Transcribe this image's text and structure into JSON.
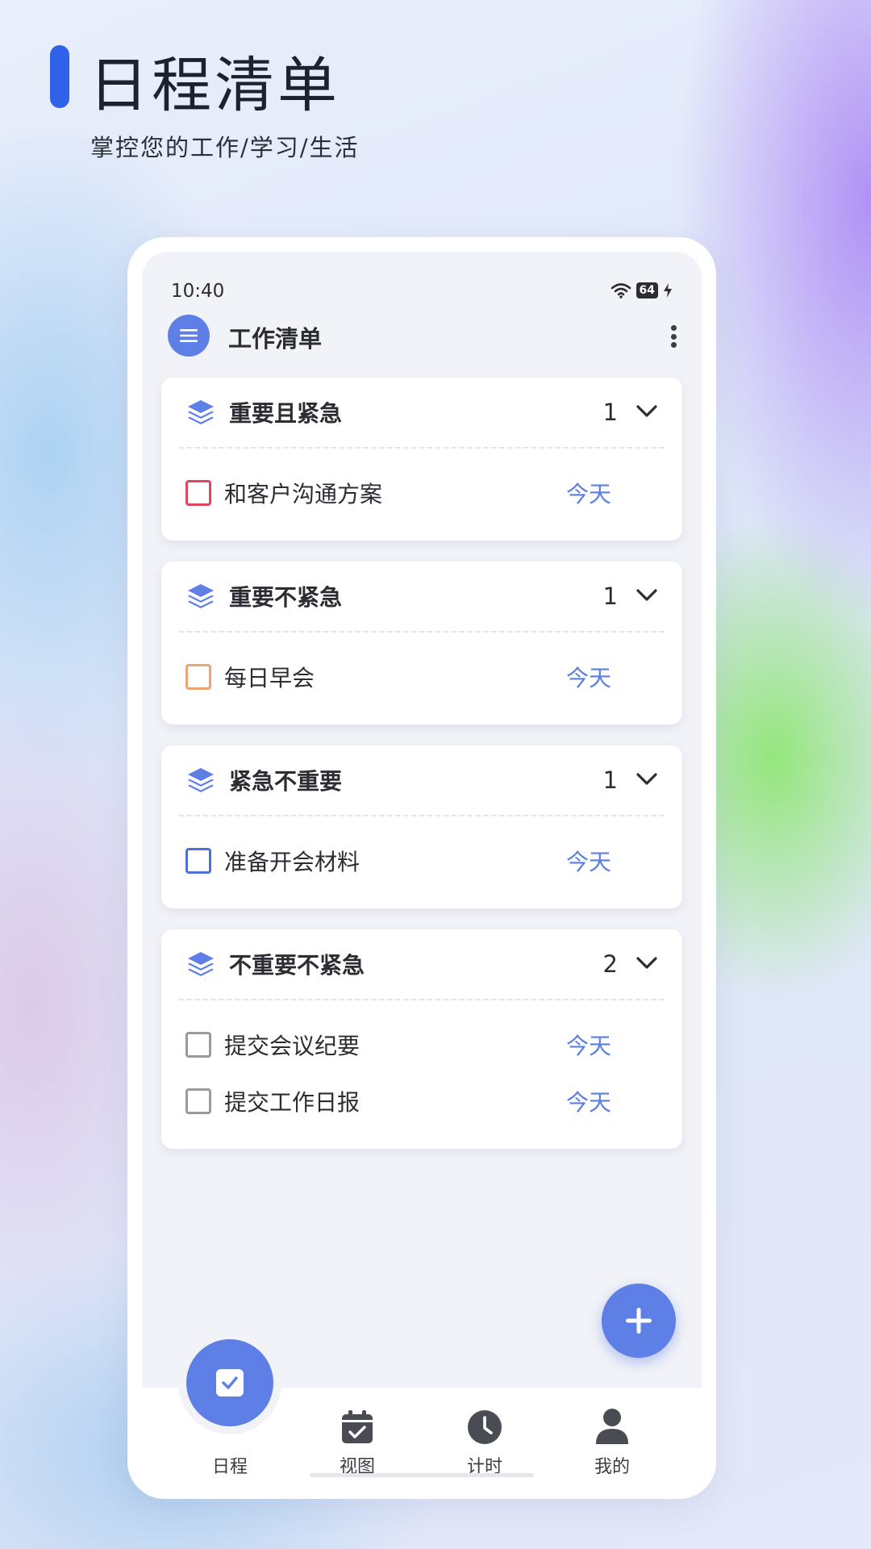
{
  "hero": {
    "title": "日程清单",
    "subtitle": "掌控您的工作/学习/生活"
  },
  "status_bar": {
    "time": "10:40",
    "battery": "64"
  },
  "header": {
    "title": "工作清单"
  },
  "colors": {
    "accent": "#5e7fe6",
    "brand_bar": "#2f62e8",
    "date_text": "#5b7fe0",
    "urgent_important": "#e0455f",
    "important": "#f0a474",
    "urgent": "#4d6fd6",
    "neither": "#9a9a9a"
  },
  "quadrants": [
    {
      "title": "重要且紧急",
      "count": "1",
      "tasks": [
        {
          "text": "和客户沟通方案",
          "date": "今天"
        }
      ]
    },
    {
      "title": "重要不紧急",
      "count": "1",
      "tasks": [
        {
          "text": "每日早会",
          "date": "今天"
        }
      ]
    },
    {
      "title": "紧急不重要",
      "count": "1",
      "tasks": [
        {
          "text": "准备开会材料",
          "date": "今天"
        }
      ]
    },
    {
      "title": "不重要不紧急",
      "count": "2",
      "tasks": [
        {
          "text": "提交会议纪要",
          "date": "今天"
        },
        {
          "text": "提交工作日报",
          "date": "今天"
        }
      ]
    }
  ],
  "tabs": [
    {
      "label": "日程",
      "icon": "checklist-icon",
      "active": true
    },
    {
      "label": "视图",
      "icon": "calendar-icon"
    },
    {
      "label": "计时",
      "icon": "clock-icon"
    },
    {
      "label": "我的",
      "icon": "person-icon"
    }
  ]
}
